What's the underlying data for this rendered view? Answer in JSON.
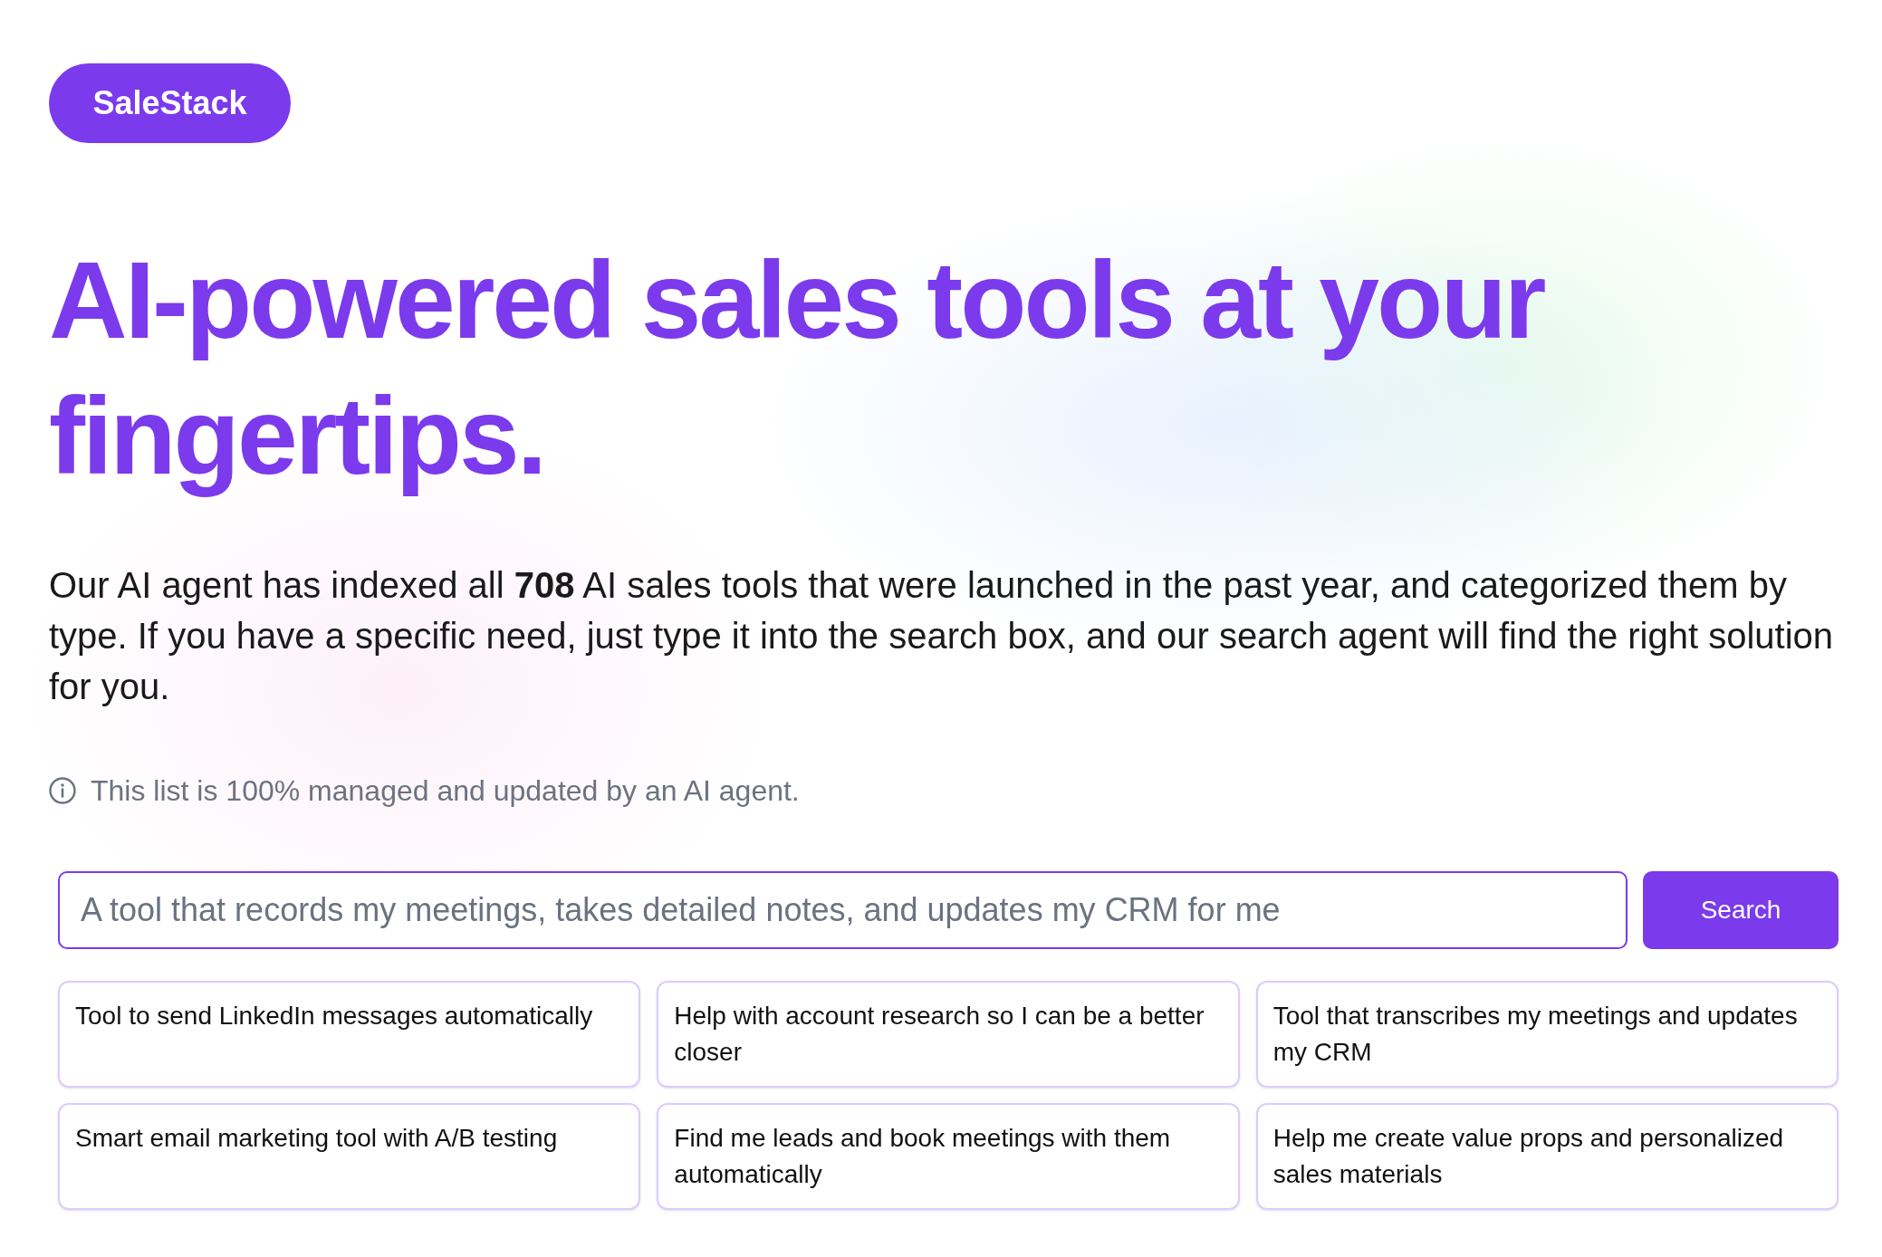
{
  "logo": {
    "text": "SaleStack"
  },
  "headline": "AI-powered sales tools at your fingertips.",
  "intro": "Our AI agent has indexed all **708** AI sales tools that were launched in the past year, and categorized them by type. If you have a specific need, just type it into the search box, and our search agent will find the right solution for you.",
  "notice": {
    "text": "This list is 100% managed and updated by an AI agent."
  },
  "search": {
    "placeholder": "A tool that records my meetings, takes detailed notes, and updates my CRM for me",
    "button": "Search"
  },
  "suggestions": [
    "Tool to send LinkedIn messages automatically",
    "Help with account research so I can be a better closer",
    "Tool that transcribes my meetings and updates my CRM",
    "Smart email marketing tool with A/B testing",
    "Find me leads and book meetings with them automatically",
    "Help me create value props and personalized sales materials"
  ]
}
